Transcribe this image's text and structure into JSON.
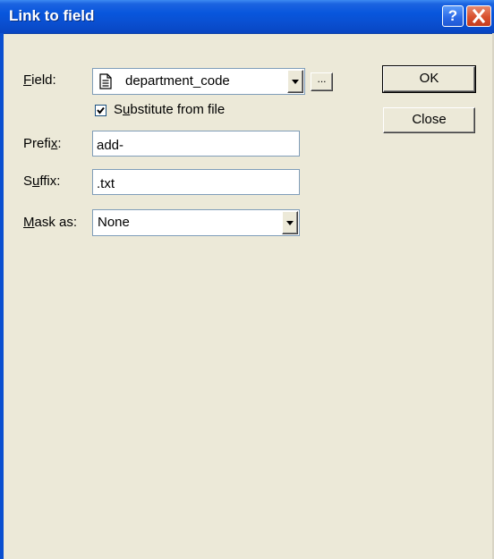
{
  "window": {
    "title": "Link to field",
    "help_glyph": "?",
    "close_glyph": "✕"
  },
  "form": {
    "field_label": "Field:",
    "field_label_mnemonic": "F",
    "field_label_rest": "ield:",
    "field_value": "department_code",
    "browse_label": "...",
    "substitute_checked": true,
    "substitute_pre": "S",
    "substitute_mnemonic": "u",
    "substitute_rest": "bstitute from file",
    "prefix_pre": "Prefi",
    "prefix_mnemonic": "x",
    "prefix_post": ":",
    "prefix_value": "add-",
    "suffix_pre": "S",
    "suffix_mnemonic": "u",
    "suffix_rest": "ffix:",
    "suffix_value": ".txt",
    "mask_mnemonic": "M",
    "mask_rest": "ask as:",
    "mask_value": "None"
  },
  "buttons": {
    "ok": "OK",
    "close": "Close"
  },
  "icons": {
    "field_type": "document-icon",
    "dropdown": "chevron-down-icon",
    "check": "check-icon"
  }
}
